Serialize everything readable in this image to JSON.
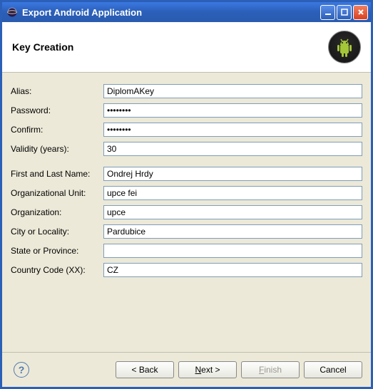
{
  "window": {
    "title": "Export Android Application"
  },
  "header": {
    "title": "Key Creation"
  },
  "form": {
    "alias_label": "Alias:",
    "alias_value": "DiplomAKey",
    "password_label": "Password:",
    "password_value": "••••••••",
    "confirm_label": "Confirm:",
    "confirm_value": "••••••••",
    "validity_label": "Validity (years):",
    "validity_value": "30",
    "name_label": "First and Last Name:",
    "name_value": "Ondrej Hrdy",
    "ou_label": "Organizational Unit:",
    "ou_value": "upce fei",
    "org_label": "Organization:",
    "org_value": "upce",
    "city_label": "City or Locality:",
    "city_value": "Pardubice",
    "state_label": "State or Province:",
    "state_value": "",
    "country_label": "Country Code (XX):",
    "country_value": "CZ"
  },
  "buttons": {
    "back": "< Back",
    "next_prefix": "N",
    "next_rest": "ext >",
    "finish_prefix": "F",
    "finish_rest": "inish",
    "cancel": "Cancel"
  }
}
